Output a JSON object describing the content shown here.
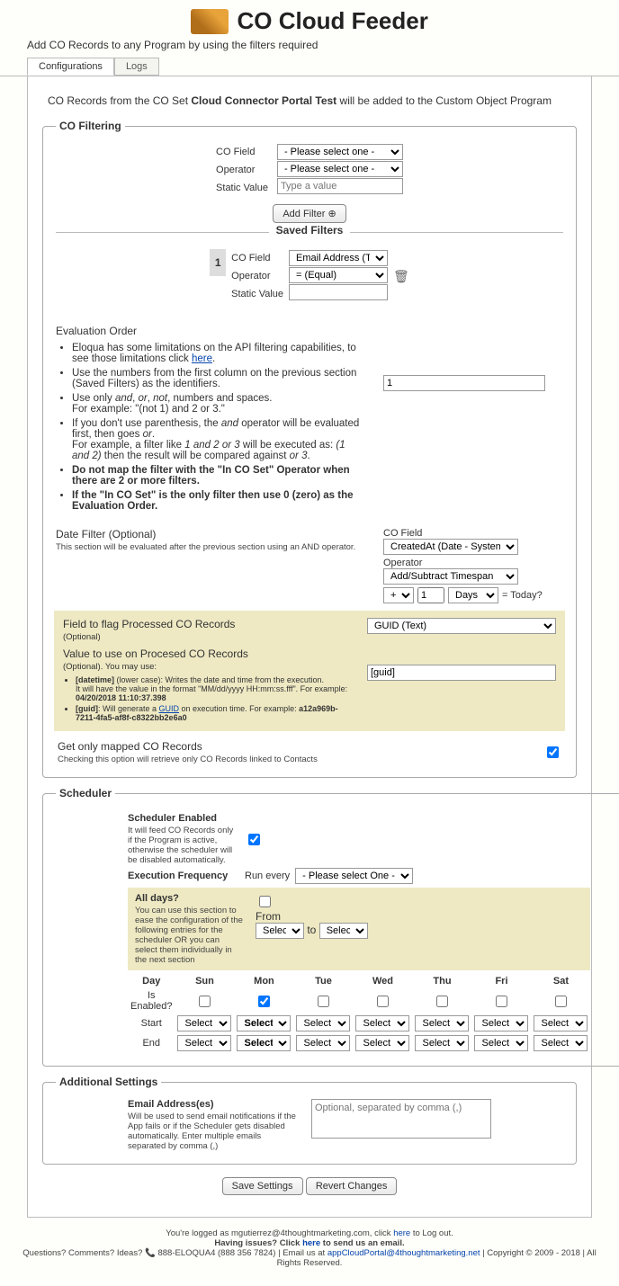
{
  "header": {
    "title": "CO Cloud Feeder",
    "subtitle": "Add CO Records to any Program by using the filters required"
  },
  "tabs": {
    "active": "Configurations",
    "other": "Logs"
  },
  "intro": {
    "pre": "CO Records from the CO Set ",
    "bold": "Cloud Connector Portal Test",
    "post": " will be added to the Custom Object Program"
  },
  "cofilter": {
    "legend": "CO Filtering",
    "lbl_field": "CO Field",
    "lbl_op": "Operator",
    "lbl_static": "Static Value",
    "sel_field_ph": "- Please select one -",
    "sel_op_ph": "- Please select one -",
    "input_ph": "Type a value",
    "add_btn": "Add Filter ⊕",
    "saved_title": "Saved Filters",
    "num": "1",
    "sf_field": "Email Address (Text)",
    "sf_op": "= (Equal)",
    "eval_head": "Evaluation Order",
    "li1a": "Eloqua has some limitations on the API filtering capabilities, to see those limitations click ",
    "li1b": "here",
    "li1c": ".",
    "li2": "Use the numbers from the first column on the previous section (Saved Filters) as the identifiers.",
    "li3a": "Use only ",
    "li3b": "and",
    "li3c": ", ",
    "li3d": "or",
    "li3e": ", ",
    "li3f": "not",
    "li3g": ", numbers and spaces.",
    "li3h": "For example: \"(not 1) and 2 or 3.\"",
    "li4a": "If you don't use parenthesis, the ",
    "li4b": "and",
    "li4c": " operator will be evaluated first, then goes ",
    "li4d": "or",
    "li4e": ".",
    "li4f": "For example, a filter like ",
    "li4g": "1 and 2 or 3",
    "li4h": " will be executed as: ",
    "li4i": "(1 and 2)",
    "li4j": " then the result will be compared against ",
    "li4k": "or 3",
    "li4l": ".",
    "li5": "Do not map the filter with the \"In CO Set\" Operator when there are 2 or more filters.",
    "li6": "If the \"In CO Set\" is the only filter then use 0 (zero) as the Evaluation Order.",
    "eval_val": "1",
    "datef_lbl": "Date Filter (Optional)",
    "datef_note": "This section will be evaluated after the previous section using an AND operator.",
    "co_field2_lbl": "CO Field",
    "co_field2_val": "CreatedAt (Date - System)",
    "op2_lbl": "Operator",
    "op2_val": "Add/Subtract Timespan",
    "pm": "+",
    "num1": "1",
    "unit": "Days",
    "today": "= Today?",
    "yb1_hd": "Field to flag Processed CO Records",
    "yb1_opt": "(Optional)",
    "yb1_sel": "GUID (Text)",
    "yb2_hd": "Value to use on Procesed CO Records",
    "yb2_opt": "(Optional). You may use:",
    "tip1a": "[datetime]",
    "tip1b": " (lower case): Writes the date and time from the execution.",
    "tip1c": "It will have the value in the format \"MM/dd/yyyy HH:mm:ss.fff\". For example: ",
    "tip1d": "04/20/2018 11:10:37.398",
    "tip2a": "[guid]",
    "tip2b": ": Will generate a ",
    "tip2c": "GUID",
    "tip2d": " on execution time. For example: ",
    "tip2e": "a12a969b-7211-4fa5-af8f-c8322bb2e6a0",
    "yb2_val": "[guid]",
    "getonly_lbl": "Get only mapped CO Records",
    "getonly_note": "Checking this option will retrieve only CO Records linked to Contacts"
  },
  "sched": {
    "legend": "Scheduler",
    "en_lbl": "Scheduler Enabled",
    "en_note": "It will feed CO Records only if the Program is active, otherwise the scheduler will be disabled automatically.",
    "freq_lbl": "Execution Frequency",
    "freq_pre": "Run every",
    "freq_sel": "- Please select One -",
    "ad_lbl": "All days?",
    "ad_note": "You can use this section to ease the configuration of the following entries for the scheduler OR you can select them individually in the next section",
    "from": "From",
    "to": "to",
    "sel": "Select",
    "hdr_day": "Day",
    "d_sun": "Sun",
    "d_mon": "Mon",
    "d_tue": "Tue",
    "d_wed": "Wed",
    "d_thu": "Thu",
    "d_fri": "Fri",
    "d_sat": "Sat",
    "row_en": "Is Enabled?",
    "row_start": "Start",
    "row_end": "End"
  },
  "addl": {
    "legend": "Additional Settings",
    "email_lbl": "Email Address(es)",
    "email_note": "Will be used to send email notifications if the App fails or if the Scheduler gets disabled automatically. Enter multiple emails separated by comma (,)",
    "email_ph": "Optional, separated by comma (,)"
  },
  "buttons": {
    "save": "Save Settings",
    "revert": "Revert Changes"
  },
  "footer": {
    "l1a": "You're logged as mgutierrez@4thoughtmarketing.com, click ",
    "l1b": "here",
    "l1c": " to Log out.",
    "l2a": "Having issues? Click ",
    "l2b": "here",
    "l2c": " to send us an email.",
    "l3a": "Questions? Comments? Ideas? ",
    "l3b": "📞",
    "l3c": " 888-ELOQUA4 (888 356 7824) | Email us at ",
    "l3d": "appCloudPortal@4thoughtmarketing.net",
    "l3e": " | Copyright © 2009 - 2018 | All Rights Reserved."
  }
}
